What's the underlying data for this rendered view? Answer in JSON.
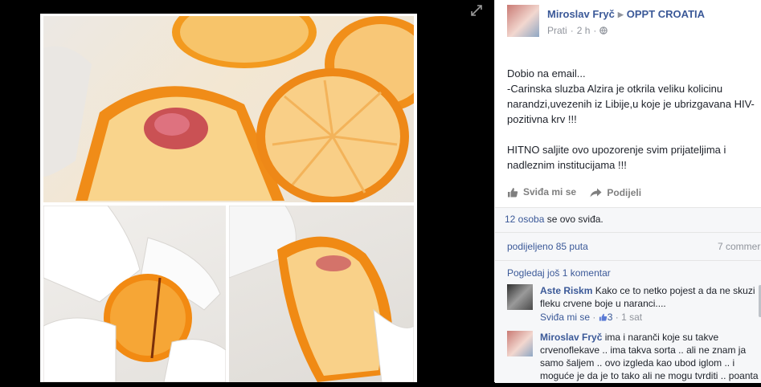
{
  "post": {
    "author": "Miroslav Fryč",
    "group": "OPPT CROATIA",
    "follow_label": "Prati",
    "time": "2 h",
    "privacy_icon": "globe-icon",
    "text_lines": [
      "Dobio na email...",
      "-Carinska sluzba Alzira je otkrila veliku kolicinu narandzi,uvezenih iz Libije,u koje je ubrizgavana HIV-pozitivna krv !!!",
      "",
      "HITNO saljite ovo upozorenje svim prijateljima i nadleznim institucijama !!!"
    ]
  },
  "actions": {
    "like_label": "Sviđa mi se",
    "share_label": "Podijeli"
  },
  "likes": {
    "count_link": "12 osoba",
    "suffix": " se ovo sviđa."
  },
  "shares": {
    "label": "podijeljeno 85 puta",
    "comments_count": "7 commer"
  },
  "comments": {
    "view_more": "Pogledaj još 1 komentar",
    "items": [
      {
        "author": "Aste Riskm",
        "text": "Kako ce to netko pojest a da ne skuzi fleku crvene boje u naranci....",
        "like_label": "Sviđa mi se",
        "likes": "3",
        "time": "1 sat"
      },
      {
        "author": "Miroslav Fryč",
        "text": "ima i naranči koje su takve crvenoflekave .. ima takva sorta .. ali ne znam ja samo šaljem .. ovo izgleda kao ubod iglom .. i moguće je da je to tako ali ne mogu tvrditi .. poanta"
      }
    ]
  },
  "colors": {
    "link": "#3b5998",
    "muted": "#90949c",
    "text": "#1d2129",
    "panel_bg": "#ffffff",
    "stage_bg": "#000000"
  }
}
